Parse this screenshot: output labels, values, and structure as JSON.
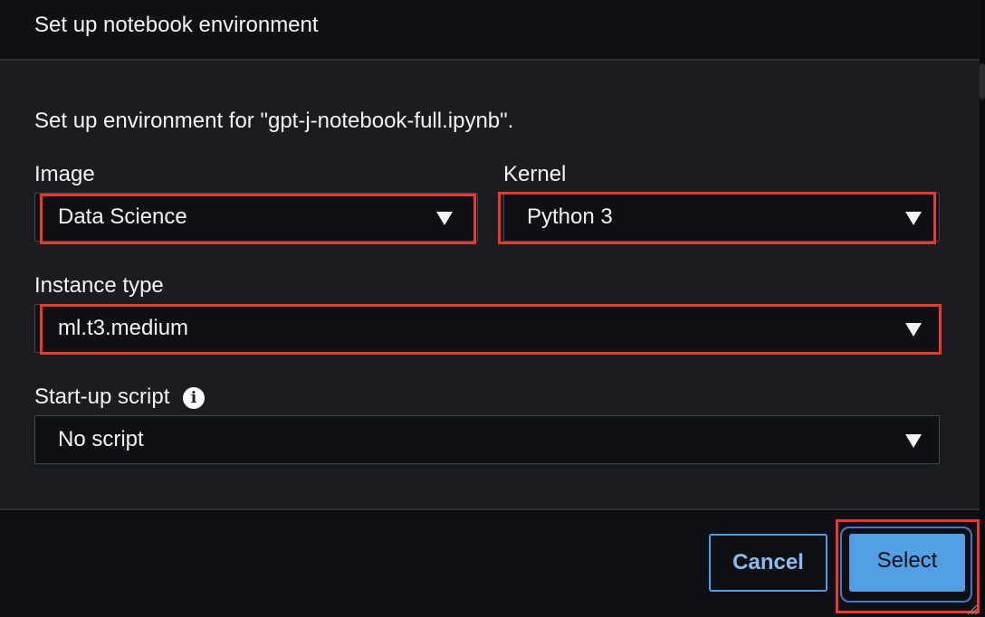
{
  "dialog": {
    "title": "Set up notebook environment",
    "intro": "Set up environment for \"gpt-j-notebook-full.ipynb\"."
  },
  "fields": {
    "image": {
      "label": "Image",
      "value": "Data Science"
    },
    "kernel": {
      "label": "Kernel",
      "value": "Python 3"
    },
    "instance_type": {
      "label": "Instance type",
      "value": "ml.t3.medium"
    },
    "startup_script": {
      "label": "Start-up script",
      "value": "No script"
    }
  },
  "footer": {
    "cancel_label": "Cancel",
    "select_label": "Select"
  },
  "icons": {
    "dropdown": "caret-down-icon",
    "info": "info-icon",
    "info_glyph": "i",
    "resize": "resize-grip-icon"
  },
  "colors": {
    "highlight": "#e8392b",
    "primary_button": "#539fe5",
    "header_bg": "#0f1013",
    "body_bg": "#1b1c20"
  }
}
